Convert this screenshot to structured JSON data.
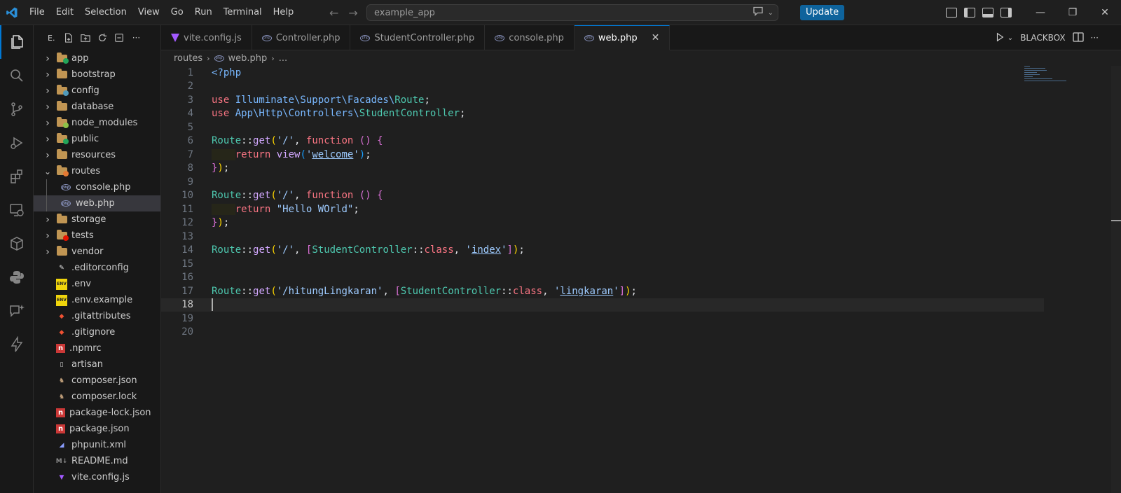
{
  "titlebar": {
    "menu": [
      "File",
      "Edit",
      "Selection",
      "View",
      "Go",
      "Run",
      "Terminal",
      "Help"
    ],
    "search_text": "example_app",
    "update_label": "Update"
  },
  "explorer": {
    "header_label": "E.",
    "items": [
      {
        "label": "app",
        "type": "folder",
        "icon_color": "#23a55a"
      },
      {
        "label": "bootstrap",
        "type": "folder",
        "icon_color": "#c09553"
      },
      {
        "label": "config",
        "type": "folder",
        "icon_color": "#519aba"
      },
      {
        "label": "database",
        "type": "folder",
        "icon_color": "#c09553"
      },
      {
        "label": "node_modules",
        "type": "folder",
        "icon_color": "#8dc149"
      },
      {
        "label": "public",
        "type": "folder",
        "icon_color": "#23a55a"
      },
      {
        "label": "resources",
        "type": "folder",
        "icon_color": "#c09553"
      },
      {
        "label": "routes",
        "type": "folder-open",
        "icon_color": "#e37933"
      },
      {
        "label": "console.php",
        "type": "file-php"
      },
      {
        "label": "web.php",
        "type": "file-php",
        "selected": true
      },
      {
        "label": "storage",
        "type": "folder",
        "icon_color": "#c09553"
      },
      {
        "label": "tests",
        "type": "folder",
        "icon_color": "#e51400"
      },
      {
        "label": "vendor",
        "type": "folder",
        "icon_color": "#c09553"
      },
      {
        "label": ".editorconfig",
        "type": "file",
        "icon": "editorconfig-icon",
        "icon_text": "✎",
        "icon_color": "#e8e8e8"
      },
      {
        "label": ".env",
        "type": "file",
        "icon": "env-icon",
        "icon_text": "ENV",
        "icon_color": "#f0d50c"
      },
      {
        "label": ".env.example",
        "type": "file",
        "icon": "env-icon",
        "icon_text": "ENV",
        "icon_color": "#f0d50c"
      },
      {
        "label": ".gitattributes",
        "type": "file",
        "icon": "git-icon",
        "icon_text": "◆",
        "icon_color": "#f05133"
      },
      {
        "label": ".gitignore",
        "type": "file",
        "icon": "git-icon",
        "icon_text": "◆",
        "icon_color": "#f05133"
      },
      {
        "label": ".npmrc",
        "type": "file",
        "icon": "npm-icon",
        "icon_text": "n",
        "icon_color": "#cb3837"
      },
      {
        "label": "artisan",
        "type": "file",
        "icon": "file-icon",
        "icon_text": "▯",
        "icon_color": "#cccccc"
      },
      {
        "label": "composer.json",
        "type": "file",
        "icon": "composer-icon",
        "icon_text": "♞",
        "icon_color": "#c6a47e"
      },
      {
        "label": "composer.lock",
        "type": "file",
        "icon": "composer-icon",
        "icon_text": "♞",
        "icon_color": "#c6a47e"
      },
      {
        "label": "package-lock.json",
        "type": "file",
        "icon": "npm-icon",
        "icon_text": "n",
        "icon_color": "#cb3837"
      },
      {
        "label": "package.json",
        "type": "file",
        "icon": "npm-icon",
        "icon_text": "n",
        "icon_color": "#cb3837"
      },
      {
        "label": "phpunit.xml",
        "type": "file",
        "icon": "phpunit-icon",
        "icon_text": "◢",
        "icon_color": "#8b9eff"
      },
      {
        "label": "README.md",
        "type": "file",
        "icon": "markdown-icon",
        "icon_text": "M↓",
        "icon_color": "#888888"
      },
      {
        "label": "vite.config.js",
        "type": "file",
        "icon": "vite-icon",
        "icon_text": "▼",
        "icon_color": "#a259ff"
      }
    ]
  },
  "tabs": [
    {
      "label": "vite.config.js",
      "icon": "vite"
    },
    {
      "label": "Controller.php",
      "icon": "php"
    },
    {
      "label": "StudentController.php",
      "icon": "php"
    },
    {
      "label": "console.php",
      "icon": "php"
    },
    {
      "label": "web.php",
      "icon": "php",
      "active": true
    }
  ],
  "tab_actions": {
    "blackbox_label": "BLACKBOX"
  },
  "breadcrumb": {
    "folder": "routes",
    "file": "web.php",
    "tail": "..."
  },
  "editor": {
    "current_line": 18,
    "lines": [
      [
        [
          "<?php",
          "t-tag"
        ]
      ],
      [],
      [
        [
          "use ",
          "t-kw"
        ],
        [
          "Illuminate\\Support\\Facades\\",
          "t-ns"
        ],
        [
          "Route",
          "t-cls"
        ],
        [
          ";",
          "t-pun"
        ]
      ],
      [
        [
          "use ",
          "t-kw"
        ],
        [
          "App\\Http\\Controllers\\",
          "t-ns"
        ],
        [
          "StudentController",
          "t-cls"
        ],
        [
          ";",
          "t-pun"
        ]
      ],
      [],
      [
        [
          "Route",
          "t-cls"
        ],
        [
          "::",
          "t-pun"
        ],
        [
          "get",
          "t-fn"
        ],
        [
          "(",
          "t-br1"
        ],
        [
          "'/'",
          "t-str"
        ],
        [
          ", ",
          "t-pun"
        ],
        [
          "function ",
          "t-kw"
        ],
        [
          "()",
          "t-br2"
        ],
        [
          " ",
          "t-pun"
        ],
        [
          "{",
          "t-br2"
        ]
      ],
      [
        [
          "    ",
          "indent"
        ],
        [
          "return ",
          "t-kw"
        ],
        [
          "view",
          "t-fn"
        ],
        [
          "(",
          "t-br3"
        ],
        [
          "'",
          "t-str"
        ],
        [
          "welcome",
          "t-str t-ul"
        ],
        [
          "'",
          "t-str"
        ],
        [
          ")",
          "t-br3"
        ],
        [
          ";",
          "t-pun"
        ]
      ],
      [
        [
          "}",
          "t-br2"
        ],
        [
          ")",
          "t-br1"
        ],
        [
          ";",
          "t-pun"
        ]
      ],
      [],
      [
        [
          "Route",
          "t-cls"
        ],
        [
          "::",
          "t-pun"
        ],
        [
          "get",
          "t-fn"
        ],
        [
          "(",
          "t-br1"
        ],
        [
          "'/'",
          "t-str"
        ],
        [
          ", ",
          "t-pun"
        ],
        [
          "function ",
          "t-kw"
        ],
        [
          "()",
          "t-br2"
        ],
        [
          " ",
          "t-pun"
        ],
        [
          "{",
          "t-br2"
        ]
      ],
      [
        [
          "    ",
          "indent"
        ],
        [
          "return ",
          "t-kw"
        ],
        [
          "\"Hello WOrld\"",
          "t-str"
        ],
        [
          ";",
          "t-pun"
        ]
      ],
      [
        [
          "}",
          "t-br2"
        ],
        [
          ")",
          "t-br1"
        ],
        [
          ";",
          "t-pun"
        ]
      ],
      [],
      [
        [
          "Route",
          "t-cls"
        ],
        [
          "::",
          "t-pun"
        ],
        [
          "get",
          "t-fn"
        ],
        [
          "(",
          "t-br1"
        ],
        [
          "'/'",
          "t-str"
        ],
        [
          ", ",
          "t-pun"
        ],
        [
          "[",
          "t-br2"
        ],
        [
          "StudentController",
          "t-cls"
        ],
        [
          "::",
          "t-pun"
        ],
        [
          "class",
          "t-kw"
        ],
        [
          ", ",
          "t-pun"
        ],
        [
          "'",
          "t-str"
        ],
        [
          "index",
          "t-str t-ul"
        ],
        [
          "'",
          "t-str"
        ],
        [
          "]",
          "t-br2"
        ],
        [
          ")",
          "t-br1"
        ],
        [
          ";",
          "t-pun"
        ]
      ],
      [],
      [],
      [
        [
          "Route",
          "t-cls"
        ],
        [
          "::",
          "t-pun"
        ],
        [
          "get",
          "t-fn"
        ],
        [
          "(",
          "t-br1"
        ],
        [
          "'/hitungLingkaran'",
          "t-str"
        ],
        [
          ", ",
          "t-pun"
        ],
        [
          "[",
          "t-br2"
        ],
        [
          "StudentController",
          "t-cls"
        ],
        [
          "::",
          "t-pun"
        ],
        [
          "class",
          "t-kw"
        ],
        [
          ", ",
          "t-pun"
        ],
        [
          "'",
          "t-str"
        ],
        [
          "lingkaran",
          "t-str t-ul"
        ],
        [
          "'",
          "t-str"
        ],
        [
          "]",
          "t-br2"
        ],
        [
          ")",
          "t-br1"
        ],
        [
          ";",
          "t-pun"
        ]
      ],
      [],
      [],
      []
    ]
  }
}
